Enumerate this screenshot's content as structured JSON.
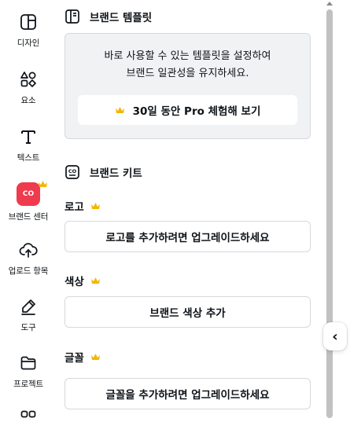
{
  "rail": {
    "items": [
      {
        "label": "디자인",
        "icon": "layout-icon"
      },
      {
        "label": "요소",
        "icon": "shapes-icon"
      },
      {
        "label": "텍스트",
        "icon": "text-icon"
      },
      {
        "label": "브랜드 센터",
        "icon": "brand-center-icon"
      },
      {
        "label": "업로드 항목",
        "icon": "cloud-upload-icon"
      },
      {
        "label": "도구",
        "icon": "pen-tool-icon"
      },
      {
        "label": "프로젝트",
        "icon": "folder-icon"
      },
      {
        "label": "",
        "icon": "apps-icon"
      }
    ],
    "brand_badge_text": "CO"
  },
  "panel": {
    "templates": {
      "title": "브랜드 템플릿",
      "description_line1": "바로 사용할 수 있는 템플릿을 설정하여",
      "description_line2": "브랜드 일관성을 유지하세요.",
      "trial_button": "30일 동안 Pro 체험해 보기"
    },
    "kit": {
      "title": "브랜드 키트",
      "logo": {
        "label": "로고",
        "button": "로고를 추가하려면 업그레이드하세요"
      },
      "color": {
        "label": "색상",
        "button": "브랜드 색상 추가"
      },
      "font": {
        "label": "글꼴",
        "button": "글꼴을 추가하려면 업그레이드하세요"
      }
    }
  },
  "collapse_glyph": "‹",
  "colors": {
    "crown": "#f2b705",
    "brand_badge": "#ee3b4e",
    "panel_box": "#f1f2f4",
    "border": "#d6d8dc"
  }
}
